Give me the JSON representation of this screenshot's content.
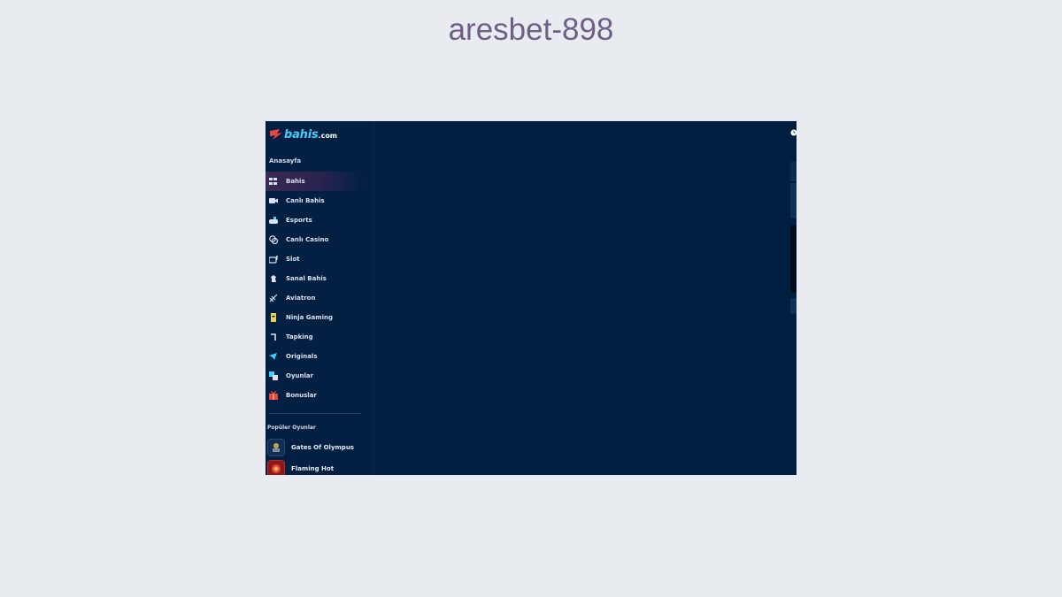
{
  "page": {
    "title": "aresbet-898"
  },
  "app": {
    "logo_text": "bahis",
    "logo_domain": ".com"
  },
  "sidebar": {
    "home_label": "Anasayfa",
    "items": [
      {
        "label": "Bahis",
        "icon": "betting-icon",
        "active": true
      },
      {
        "label": "Canlı Bahis",
        "icon": "live-video-icon"
      },
      {
        "label": "Esports",
        "icon": "gamepad-icon"
      },
      {
        "label": "Canlı Casino",
        "icon": "chips-icon"
      },
      {
        "label": "Slot",
        "icon": "slot-machine-icon"
      },
      {
        "label": "Sanal Bahis",
        "icon": "horse-icon"
      },
      {
        "label": "Aviatron",
        "icon": "plane-icon"
      },
      {
        "label": "Ninja Gaming",
        "icon": "ninja-icon"
      },
      {
        "label": "Tapking",
        "icon": "tapking-icon"
      },
      {
        "label": "Originals",
        "icon": "originals-icon"
      },
      {
        "label": "Oyunlar",
        "icon": "games-icon"
      },
      {
        "label": "Bonuslar",
        "icon": "gift-icon"
      }
    ],
    "popular_label": "Popüler Oyunlar",
    "popular_games": [
      {
        "label": "Gates Of Olympus"
      },
      {
        "label": "Flaming Hot"
      }
    ]
  },
  "colors": {
    "background": "#e8ecf0",
    "title": "#6f5f86",
    "app_bg": "#001e3f",
    "sidebar_bg": "#032043",
    "accent": "#3fd0ff",
    "brand_red": "#e8463c"
  }
}
